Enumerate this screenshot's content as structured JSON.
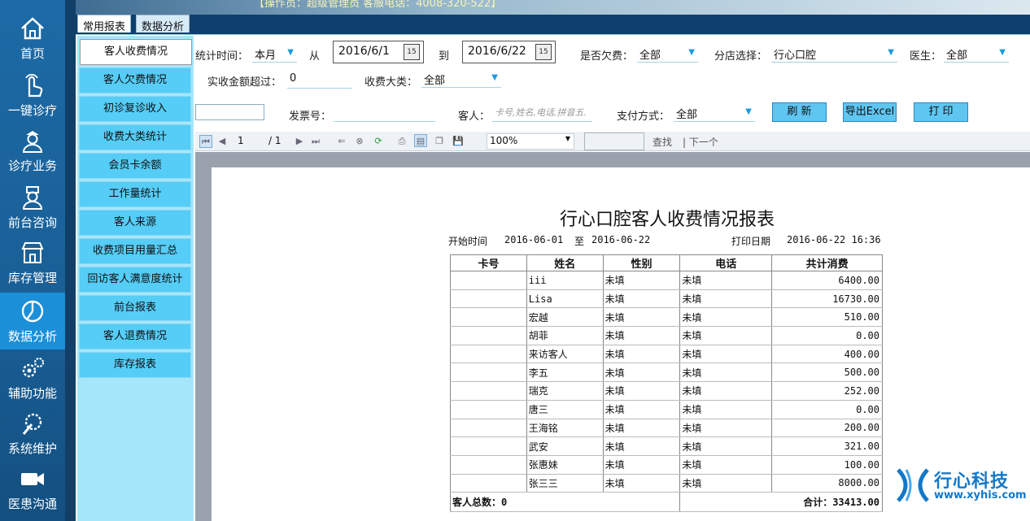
{
  "banner": {
    "ticker": "【操作员：超级管理员 客服电话：4008-320-522】"
  },
  "nav": [
    {
      "label": "首页",
      "icon": "home-icon"
    },
    {
      "label": "一键诊疗",
      "icon": "pointer-hand-icon"
    },
    {
      "label": "诊疗业务",
      "icon": "doctor-icon"
    },
    {
      "label": "前台咨询",
      "icon": "nurse-icon"
    },
    {
      "label": "库存管理",
      "icon": "store-icon"
    },
    {
      "label": "数据分析",
      "icon": "pie-chart-icon",
      "active": true
    },
    {
      "label": "辅助功能",
      "icon": "gears-icon"
    },
    {
      "label": "系统维护",
      "icon": "wrench-gear-icon"
    },
    {
      "label": "医患沟通",
      "icon": "video-camera-icon"
    }
  ],
  "tabs": [
    {
      "label": "常用报表",
      "active": true
    },
    {
      "label": "数据分析",
      "active": false
    }
  ],
  "reports": [
    "客人收费情况",
    "客人欠费情况",
    "初诊复诊收入",
    "收费大类统计",
    "会员卡余额",
    "工作量统计",
    "客人来源",
    "收费项目用量汇总",
    "回访客人满意度统计",
    "前台报表",
    "客人退费情况",
    "库存报表"
  ],
  "filters": {
    "period_label": "统计时间：",
    "period_value": "本月",
    "from_label": "从",
    "from_date": "2016/6/1",
    "to_label": "到",
    "to_date": "2016/6/22",
    "calendar_text": "15",
    "arrears_label": "是否欠费：",
    "arrears_value": "全部",
    "branch_label": "分店选择：",
    "branch_value": "行心口腔",
    "doctor_label": "医生：",
    "doctor_value": "全部",
    "amount_label": "实收金额超过：",
    "amount_value": "0",
    "category_label": "收费大类：",
    "category_value": "全部",
    "invoice_label": "发票号：",
    "invoice_value": "",
    "customer_label": "客人：",
    "customer_placeholder": "卡号,姓名,电话,拼音五.",
    "payment_label": "支付方式：",
    "payment_value": "全部"
  },
  "buttons": {
    "refresh": "刷 新",
    "export": "导出Excel",
    "print": "打 印"
  },
  "viewer": {
    "page": "1",
    "page_total": "/ 1",
    "zoom": "100%",
    "find": "查找",
    "next": "| 下一个"
  },
  "report": {
    "title": "行心口腔客人收费情况报表",
    "start_label": "开始时间",
    "start_date": "2016-06-01",
    "to_label": "至",
    "end_date": "2016-06-22",
    "print_label": "打印日期",
    "print_date": "2016-06-22 16:36",
    "columns": [
      "卡号",
      "姓名",
      "性别",
      "电话",
      "共计消费"
    ],
    "rows": [
      [
        "",
        "iii",
        "未填",
        "未填",
        "6400.00"
      ],
      [
        "",
        "Lisa",
        "未填",
        "未填",
        "16730.00"
      ],
      [
        "",
        "宏越",
        "未填",
        "未填",
        "510.00"
      ],
      [
        "",
        "胡菲",
        "未填",
        "未填",
        "0.00"
      ],
      [
        "",
        "来访客人",
        "未填",
        "未填",
        "400.00"
      ],
      [
        "",
        "李五",
        "未填",
        "未填",
        "500.00"
      ],
      [
        "",
        "瑞克",
        "未填",
        "未填",
        "252.00"
      ],
      [
        "",
        "唐三",
        "未填",
        "未填",
        "0.00"
      ],
      [
        "",
        "王海铭",
        "未填",
        "未填",
        "200.00"
      ],
      [
        "",
        "武安",
        "未填",
        "未填",
        "321.00"
      ],
      [
        "",
        "张惠妹",
        "未填",
        "未填",
        "100.00"
      ],
      [
        "",
        "张三三",
        "未填",
        "未填",
        "8000.00"
      ]
    ],
    "footer_count": "客人总数：0",
    "footer_total": "合计：33413.00"
  },
  "logo": {
    "brand": "行心科技",
    "url": "www.xyhis.com"
  },
  "colors": {
    "nav_active": "#1b8fd8",
    "report_item": "#55cdf6",
    "button": "#5fc6f2"
  }
}
